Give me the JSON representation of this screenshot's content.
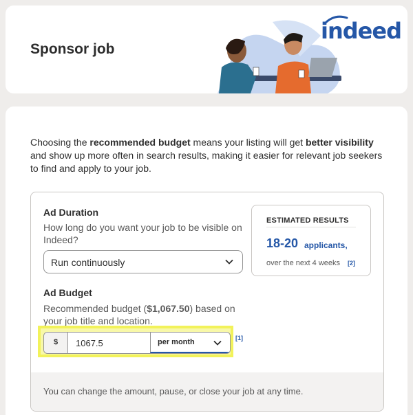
{
  "header": {
    "title": "Sponsor job",
    "brand_logo": "indeed",
    "brand_color": "#2557a7"
  },
  "intro": {
    "part1": "Choosing the ",
    "bold1": "recommended budget",
    "part2": " means your listing will get ",
    "bold2": "better visibility",
    "part3": " and show up more often in search results, making it easier for relevant job seekers to find and apply to your job."
  },
  "duration": {
    "label": "Ad Duration",
    "description": "How long do you want your job to be visible on Indeed?",
    "selected": "Run continuously",
    "icon": "chevron-down-icon"
  },
  "estimate": {
    "title": "ESTIMATED RESULTS",
    "count": "18-20",
    "unit": "applicants,",
    "period": "over the next 4 weeks",
    "ref": "[2]"
  },
  "budget": {
    "label": "Ad Budget",
    "desc_prefix": "Recommended budget (",
    "desc_amount": "$1,067.50",
    "desc_suffix": ") based on your job title and location.",
    "currency": "$",
    "amount": "1067.5",
    "period": "per month",
    "ref": "[1]",
    "highlight_color": "#f2f25a"
  },
  "note": "You can change the amount, pause, or close your job at any time."
}
